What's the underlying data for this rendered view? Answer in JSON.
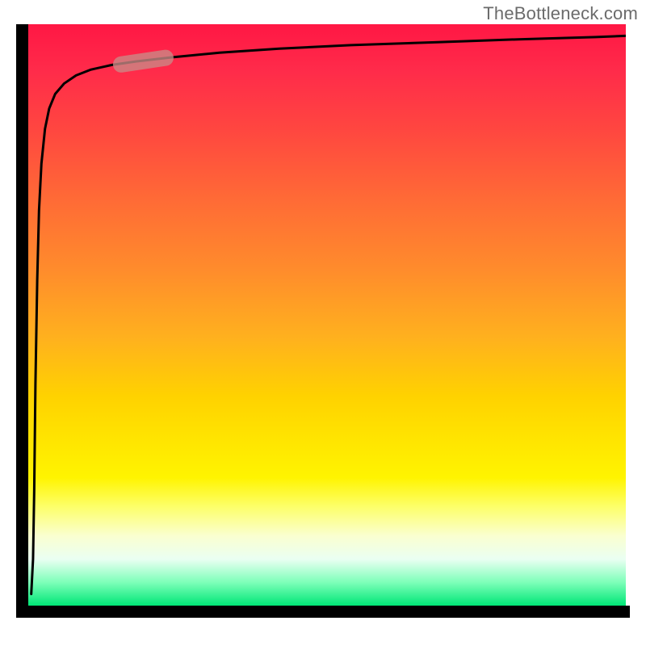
{
  "watermark": "TheBottleneck.com",
  "colors": {
    "axis": "#000000",
    "curve": "#000000",
    "marker_fill": "#c98b87",
    "marker_stroke": "#c98b87",
    "gradient_top": "#ff1744",
    "gradient_bottom": "#00e676"
  },
  "chart_data": {
    "type": "line",
    "title": "",
    "xlabel": "",
    "ylabel": "",
    "xlim": [
      0,
      100
    ],
    "ylim": [
      0,
      100
    ],
    "grid": false,
    "legend": false,
    "series": [
      {
        "name": "bottleneck-curve",
        "x": [
          0.5,
          0.8,
          1.0,
          1.2,
          1.5,
          1.8,
          2.2,
          2.8,
          3.5,
          4.5,
          6.0,
          8.0,
          10.5,
          14.0,
          18.0,
          24.0,
          32.0,
          42.0,
          54.0,
          68.0,
          82.0,
          95.0,
          100.0
        ],
        "y": [
          2.0,
          8.0,
          20.0,
          38.0,
          56.0,
          68.0,
          76.0,
          82.0,
          85.5,
          88.0,
          89.8,
          91.2,
          92.2,
          93.0,
          93.6,
          94.3,
          95.1,
          95.8,
          96.4,
          96.9,
          97.4,
          97.8,
          98.0
        ]
      }
    ],
    "marker": {
      "series": "bottleneck-curve",
      "x_range": [
        15.0,
        23.5
      ],
      "y_range": [
        93.0,
        94.3
      ],
      "shape": "pill"
    }
  }
}
